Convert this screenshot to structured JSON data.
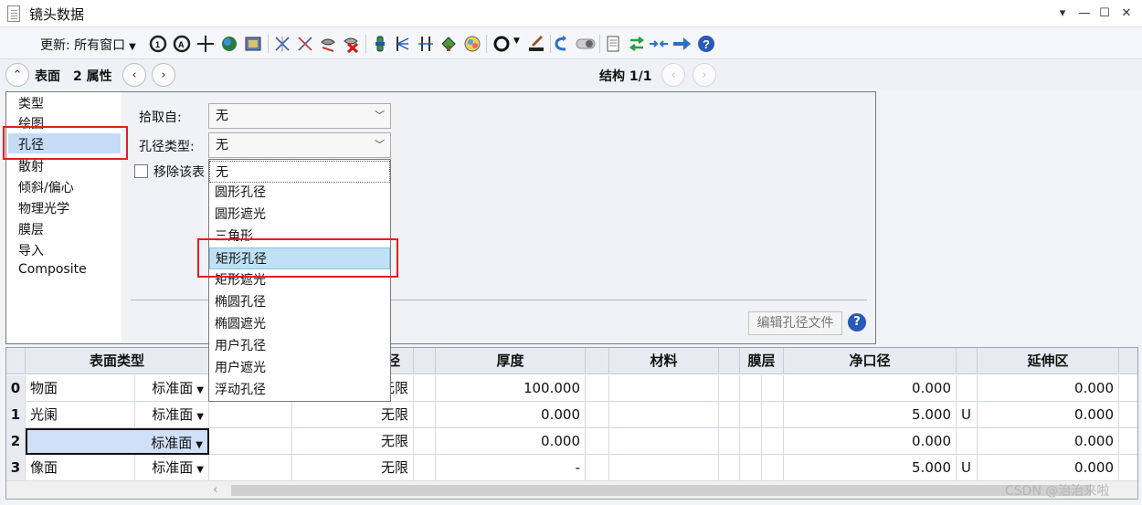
{
  "window": {
    "title": "镜头数据",
    "controls": [
      "▾",
      "—",
      "☐",
      "✕"
    ]
  },
  "toolbar": {
    "update_label": "更新: 所有窗口",
    "icons": [
      "analysis-1-icon",
      "analysis-2-icon",
      "crosshair-icon",
      "globe-icon",
      "image-icon",
      "ray-1-icon",
      "ray-2-icon",
      "footprint-icon",
      "delete-icon",
      "lens-icon",
      "optic-1-icon",
      "optic-2-icon",
      "tree-icon",
      "spot-icon",
      "ring-icon",
      "brush-icon",
      "undo-icon",
      "toggle-icon",
      "page-icon",
      "swap-icon",
      "arrows-icon",
      "arrow-right-icon",
      "help-icon"
    ]
  },
  "nav": {
    "surface_label": "表面",
    "props_label": "2 属性",
    "struct_label": "结构 1/1"
  },
  "categories": [
    "类型",
    "绘图",
    "孔径",
    "散射",
    "倾斜/偏心",
    "物理光学",
    "膜层",
    "导入",
    "Composite"
  ],
  "aperture": {
    "pick_label": "拾取自:",
    "pick_value": "无",
    "type_label": "孔径类型:",
    "type_value": "无",
    "remove_label": "移除该表",
    "edit_button": "编辑孔径文件",
    "help": "?"
  },
  "dropdown_options": [
    "无",
    "圆形孔径",
    "圆形遮光",
    "三角形",
    "矩形孔径",
    "矩形遮光",
    "椭圆孔径",
    "椭圆遮光",
    "用户孔径",
    "用户遮光",
    "浮动孔径"
  ],
  "dropdown_highlight": "矩形孔径",
  "grid": {
    "headers": {
      "surface_type": "表面类型",
      "radius": "径",
      "thickness": "厚度",
      "material": "材料",
      "coating": "膜层",
      "clear_semi_dia": "净口径",
      "extension": "延伸区"
    },
    "rows": [
      {
        "num": "0",
        "name": "物面",
        "type": "标准面",
        "radius": "无限",
        "thickness": "100.000",
        "clear": "0.000",
        "flag": "",
        "ext": "0.000"
      },
      {
        "num": "1",
        "name": "光阑",
        "type": "标准面",
        "radius": "无限",
        "thickness": "0.000",
        "clear": "5.000",
        "flag": "U",
        "ext": "0.000"
      },
      {
        "num": "2",
        "name": "",
        "type": "标准面",
        "radius": "无限",
        "thickness": "0.000",
        "clear": "0.000",
        "flag": "",
        "ext": "0.000"
      },
      {
        "num": "3",
        "name": "像面",
        "type": "标准面",
        "radius": "无限",
        "thickness": "-",
        "clear": "5.000",
        "flag": "U",
        "ext": "0.000"
      }
    ]
  },
  "watermark": "CSDN @治治来啦",
  "colors": {
    "selection": "#c5dbf6",
    "highlight": "#bfe1f5",
    "annotation_red": "#e0201e",
    "help_blue": "#2a5ab8"
  }
}
